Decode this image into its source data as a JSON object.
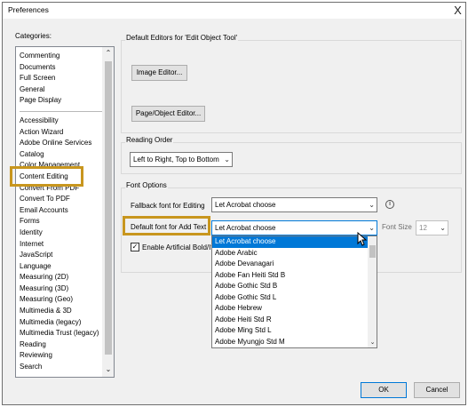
{
  "window": {
    "title": "Preferences",
    "close_glyph": "X"
  },
  "categories": {
    "label": "Categories:",
    "group1": [
      "Commenting",
      "Documents",
      "Full Screen",
      "General",
      "Page Display"
    ],
    "group2": [
      "Accessibility",
      "Action Wizard",
      "Adobe Online Services",
      "Catalog",
      "Color Management",
      "Content Editing",
      "Convert From PDF",
      "Convert To PDF",
      "Email Accounts",
      "Forms",
      "Identity",
      "Internet",
      "JavaScript",
      "Language",
      "Measuring (2D)",
      "Measuring (3D)",
      "Measuring (Geo)",
      "Multimedia & 3D",
      "Multimedia (legacy)",
      "Multimedia Trust (legacy)",
      "Reading",
      "Reviewing",
      "Search"
    ],
    "selected": "Content Editing"
  },
  "editors": {
    "title": "Default Editors for 'Edit Object Tool'",
    "image_editor": "Image Editor...",
    "page_object_editor": "Page/Object Editor..."
  },
  "reading_order": {
    "title": "Reading Order",
    "value": "Left to Right, Top to Bottom"
  },
  "font_options": {
    "title": "Font Options",
    "fallback_label": "Fallback font for Editing",
    "fallback_value": "Let Acrobat choose",
    "default_label": "Default font for Add Text",
    "default_value": "Let Acrobat choose",
    "font_size_label": "Font Size",
    "font_size_value": "12",
    "artificial_bold_label": "Enable Artificial Bold/It",
    "artificial_bold_checked": true,
    "info_glyph": "i"
  },
  "dropdown": {
    "options": [
      "Let Acrobat choose",
      "Adobe Arabic",
      "Adobe Devanagari",
      "Adobe Fan Heiti Std B",
      "Adobe Gothic Std B",
      "Adobe Gothic Std L",
      "Adobe Hebrew",
      "Adobe Heiti Std R",
      "Adobe Ming Std L",
      "Adobe Myungjo Std M"
    ],
    "highlighted": "Let Acrobat choose"
  },
  "footer": {
    "ok": "OK",
    "cancel": "Cancel"
  },
  "colors": {
    "highlight_box": "#c8961e",
    "selection": "#0078d7"
  }
}
